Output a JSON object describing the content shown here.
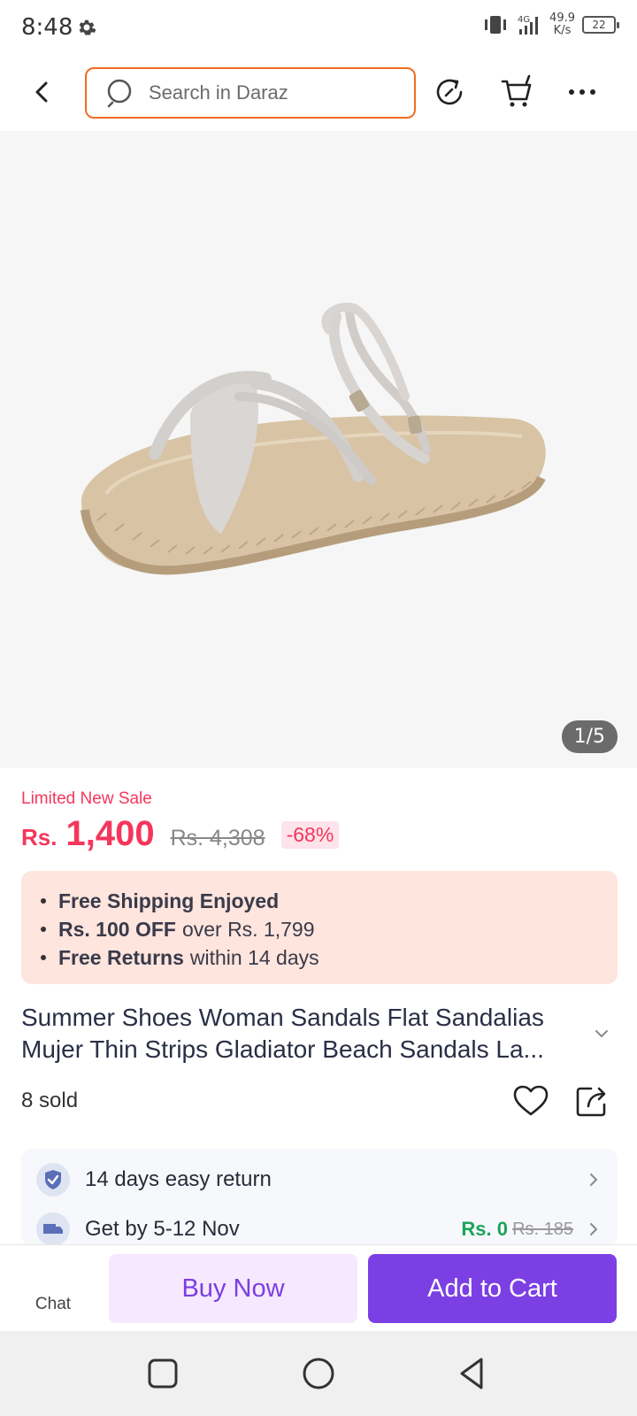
{
  "status_bar": {
    "time": "8:48",
    "net_speed_value": "49.9",
    "net_speed_unit": "K/s",
    "battery": "22"
  },
  "header": {
    "search_placeholder": "Search in Daraz"
  },
  "gallery": {
    "counter": "1/5"
  },
  "pricing": {
    "promo_label": "Limited New Sale",
    "currency": "Rs.",
    "price": "1,400",
    "old_price": "Rs. 4,308",
    "discount": "-68%"
  },
  "benefits": [
    {
      "bold": "Free Shipping Enjoyed",
      "rest": ""
    },
    {
      "bold": "Rs. 100 OFF",
      "rest": "over Rs. 1,799"
    },
    {
      "bold": "Free Returns",
      "rest": "within 14 days"
    }
  ],
  "product": {
    "title": "Summer Shoes Woman Sandals Flat Sandalias Mujer Thin Strips Gladiator Beach Sandals La...",
    "sold": "8 sold"
  },
  "services": {
    "return_policy": "14 days easy return",
    "delivery": "Get by 5-12 Nov",
    "delivery_fee": "Rs. 0",
    "delivery_fee_old": "Rs. 185"
  },
  "actions": {
    "chat": "Chat",
    "buy_now": "Buy Now",
    "add_to_cart": "Add to Cart"
  },
  "colors": {
    "brand_orange": "#f36c21",
    "price_red": "#f5365c",
    "accent_purple": "#7b3fe4",
    "benefits_bg": "#fee5dd"
  }
}
